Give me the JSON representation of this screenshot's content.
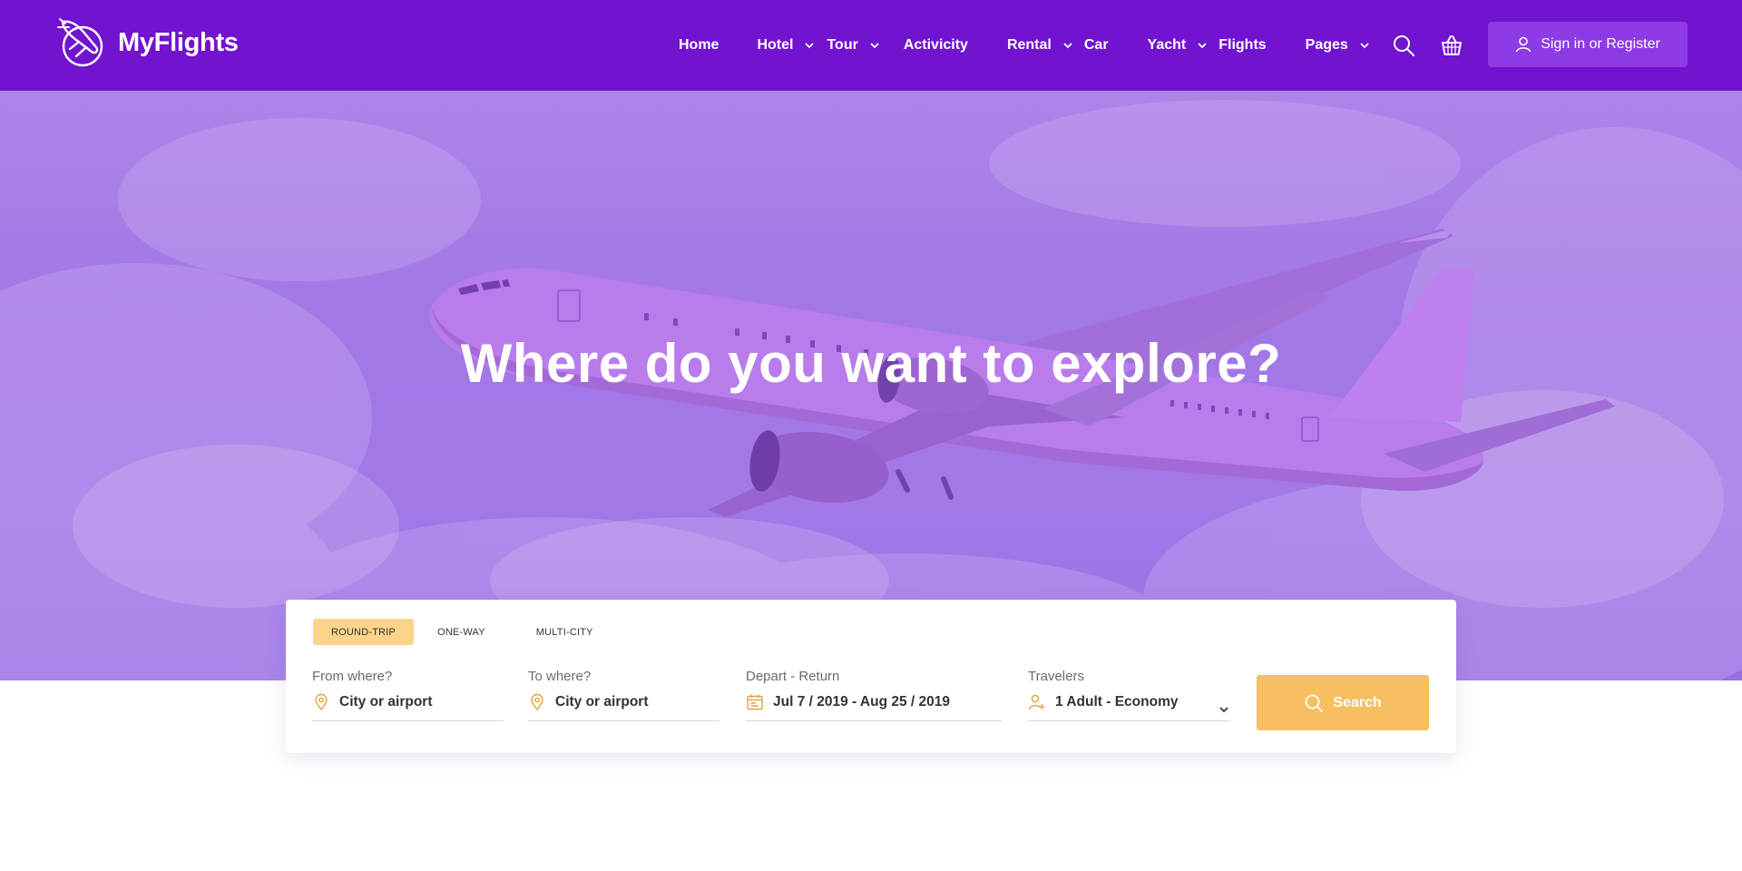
{
  "brand": {
    "name": "MyFlights"
  },
  "nav": {
    "items": [
      {
        "label": "Home",
        "dropdown": false
      },
      {
        "label": "Hotel",
        "dropdown": true
      },
      {
        "label": "Tour",
        "dropdown": true
      },
      {
        "label": "Activicity",
        "dropdown": false
      },
      {
        "label": "Rental",
        "dropdown": true
      },
      {
        "label": "Car",
        "dropdown": false
      },
      {
        "label": "Yacht",
        "dropdown": true
      },
      {
        "label": "Flights",
        "dropdown": false
      },
      {
        "label": "Pages",
        "dropdown": true
      }
    ],
    "signin_label": "Sign in or Register",
    "icons": [
      "search-icon",
      "basket-icon",
      "user-icon"
    ]
  },
  "hero": {
    "title": "Where do you want to explore?"
  },
  "search": {
    "trip_types": [
      "ROUND-TRIP",
      "ONE-WAY",
      "MULTI-CITY"
    ],
    "active_trip": "ROUND-TRIP",
    "from": {
      "label": "From where?",
      "value": "City or airport"
    },
    "to": {
      "label": "To where?",
      "value": "City or airport"
    },
    "dates": {
      "label": "Depart - Return",
      "value": "Jul 7 / 2019 - Aug 25 / 2019"
    },
    "travelers": {
      "label": "Travelers",
      "value": "1 Adult - Economy"
    },
    "button_label": "Search"
  },
  "colors": {
    "header": "#7213d0",
    "signin_bg": "#8d3be4",
    "accent": "#f7bf5f",
    "tab_active": "#fcd38a",
    "icon_gold": "#e0a43c"
  }
}
